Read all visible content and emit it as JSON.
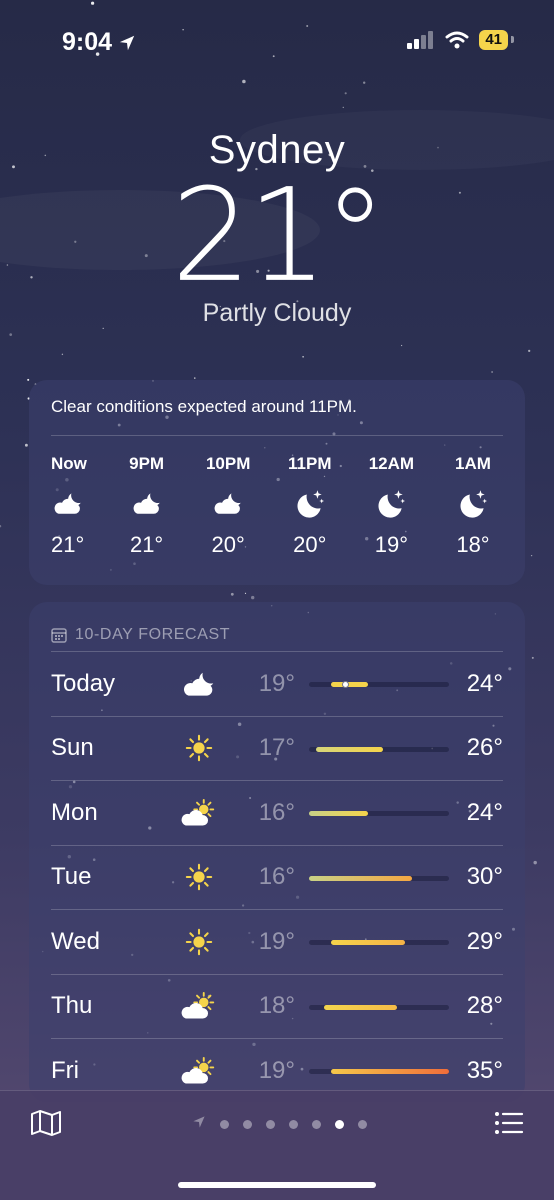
{
  "status": {
    "time": "9:04",
    "battery": "41",
    "location_icon": "location-arrow-icon",
    "signal_icon": "signal-icon",
    "wifi_icon": "wifi-icon"
  },
  "location": {
    "city": "Sydney",
    "temperature": "21°",
    "condition": "Partly Cloudy"
  },
  "hourly": {
    "summary": "Clear conditions expected around 11PM.",
    "hours": [
      {
        "label": "Now",
        "icon": "partly-cloudy-night-icon",
        "temp": "21°"
      },
      {
        "label": "9PM",
        "icon": "partly-cloudy-night-icon",
        "temp": "21°"
      },
      {
        "label": "10PM",
        "icon": "partly-cloudy-night-icon",
        "temp": "20°"
      },
      {
        "label": "11PM",
        "icon": "clear-night-icon",
        "temp": "20°"
      },
      {
        "label": "12AM",
        "icon": "clear-night-icon",
        "temp": "19°"
      },
      {
        "label": "1AM",
        "icon": "clear-night-icon",
        "temp": "18°"
      }
    ]
  },
  "forecast": {
    "title": "10-DAY FORECAST",
    "range_min": 16,
    "range_max": 35,
    "days": [
      {
        "day": "Today",
        "icon": "partly-cloudy-night-icon",
        "low": "19°",
        "high": "24°",
        "low_val": 19,
        "high_val": 24,
        "current_val": 21,
        "colors": [
          "#f5d44b",
          "#f5d44b"
        ]
      },
      {
        "day": "Sun",
        "icon": "sun-icon",
        "low": "17°",
        "high": "26°",
        "low_val": 17,
        "high_val": 26,
        "colors": [
          "#d6d57a",
          "#f5d44b"
        ]
      },
      {
        "day": "Mon",
        "icon": "partly-sunny-icon",
        "low": "16°",
        "high": "24°",
        "low_val": 16,
        "high_val": 24,
        "colors": [
          "#c9d287",
          "#f5d44b"
        ]
      },
      {
        "day": "Tue",
        "icon": "sun-icon",
        "low": "16°",
        "high": "30°",
        "low_val": 16,
        "high_val": 30,
        "colors": [
          "#c9d287",
          "#f5a742"
        ]
      },
      {
        "day": "Wed",
        "icon": "sun-icon",
        "low": "19°",
        "high": "29°",
        "low_val": 19,
        "high_val": 29,
        "colors": [
          "#f5d44b",
          "#f5b347"
        ]
      },
      {
        "day": "Thu",
        "icon": "partly-sunny-icon",
        "low": "18°",
        "high": "28°",
        "low_val": 18,
        "high_val": 28,
        "colors": [
          "#f3d54e",
          "#f5bb47"
        ]
      },
      {
        "day": "Fri",
        "icon": "partly-sunny-icon",
        "low": "19°",
        "high": "35°",
        "low_val": 19,
        "high_val": 35,
        "colors": [
          "#f5c84a",
          "#f06d3a"
        ]
      }
    ]
  },
  "pager": {
    "total": 7,
    "active_index": 5
  },
  "toolbar": {
    "map_icon": "map-icon",
    "list_icon": "list-icon"
  }
}
